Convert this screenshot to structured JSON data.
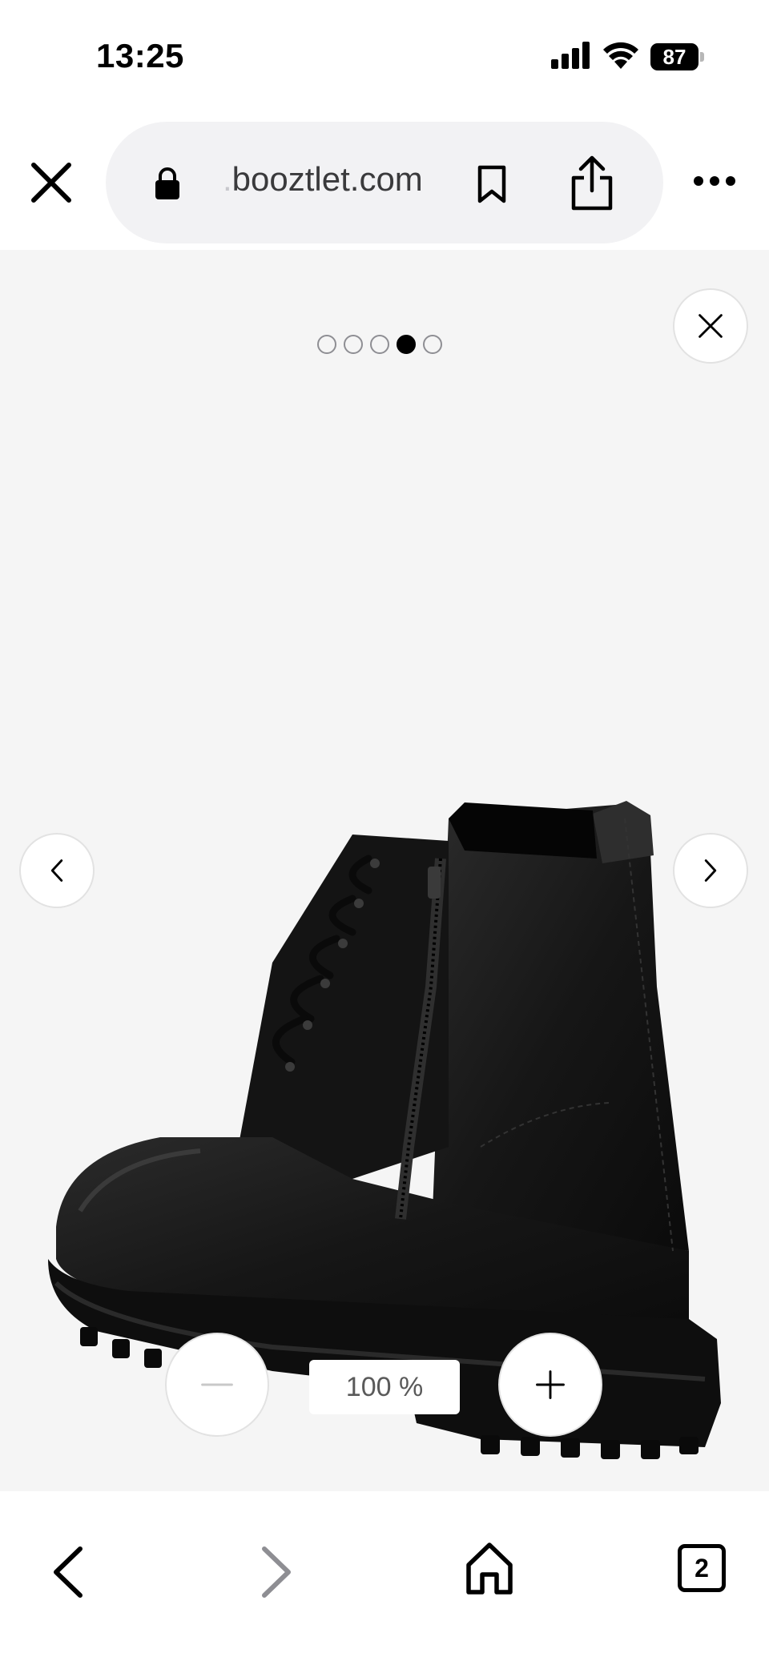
{
  "status_bar": {
    "time": "13:25",
    "battery_level": "87",
    "icons": [
      "signal-icon",
      "wifi-icon",
      "battery-icon"
    ]
  },
  "browser": {
    "url_prefix": ".",
    "url_domain": "booztlet.com",
    "icons": [
      "close-icon",
      "lock-icon",
      "bookmark-icon",
      "share-icon",
      "more-icon"
    ]
  },
  "viewer": {
    "image_count": 5,
    "active_image_index": 3,
    "zoom_level": "100 %",
    "icons": [
      "close-icon",
      "chevron-left-icon",
      "chevron-right-icon",
      "minus-icon",
      "plus-icon"
    ]
  },
  "bottom_bar": {
    "tab_count": "2",
    "icons": [
      "back-arrow-icon",
      "forward-arrow-icon",
      "home-icon",
      "tabs-icon"
    ]
  },
  "colors": {
    "viewer_background": "#f5f5f5",
    "url_pill": "#f2f2f4",
    "disabled": "#8e8e93"
  }
}
